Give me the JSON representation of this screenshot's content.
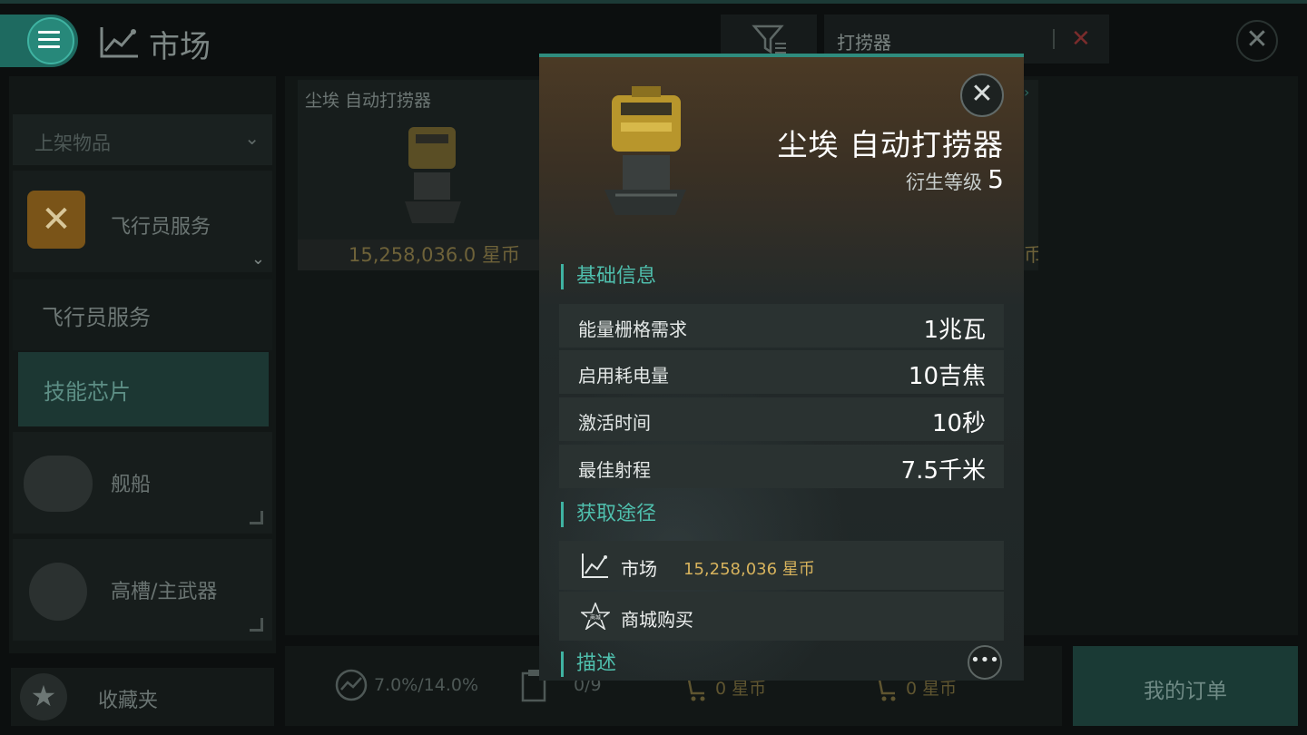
{
  "header": {
    "title": "市场",
    "search_value": "打捞器"
  },
  "sidebar": {
    "dropdown_label": "上架物品",
    "pilot_services_label": "飞行员服务",
    "sub_items": [
      {
        "label": "飞行员服务",
        "active": false
      },
      {
        "label": "技能芯片",
        "active": true
      }
    ],
    "ships_label": "舰船",
    "weapons_label": "高槽/主武器",
    "favorites_label": "收藏夹"
  },
  "listing": {
    "card1_name": "尘埃 自动打捞器",
    "card1_price": "15,258,036.0 星币",
    "card2_price_fragment": "币"
  },
  "bottom_bar": {
    "tax_rate": "7.0%/14.0%",
    "order_count": "0/9",
    "buy_total": "0 星币",
    "sell_total": "0 星币",
    "my_orders_label": "我的订单"
  },
  "modal": {
    "item_name": "尘埃 自动打捞器",
    "meta_label": "衍生等级",
    "meta_level": "5",
    "section_basic": "基础信息",
    "attributes": [
      {
        "name": "能量栅格需求",
        "value": "1兆瓦"
      },
      {
        "name": "启用耗电量",
        "value": "10吉焦"
      },
      {
        "name": "激活时间",
        "value": "10秒"
      },
      {
        "name": "最佳射程",
        "value": "7.5千米"
      }
    ],
    "section_sources": "获取途径",
    "sources": [
      {
        "label": "市场",
        "price": "15,258,036 星币",
        "icon": "market-chart-icon"
      },
      {
        "label": "商城购买",
        "icon": "shop-star-icon"
      }
    ],
    "section_description": "描述"
  },
  "colors": {
    "accent_teal": "#3fb3a2",
    "price_gold": "#d7b35d",
    "clear_red": "#7a2c2c"
  }
}
